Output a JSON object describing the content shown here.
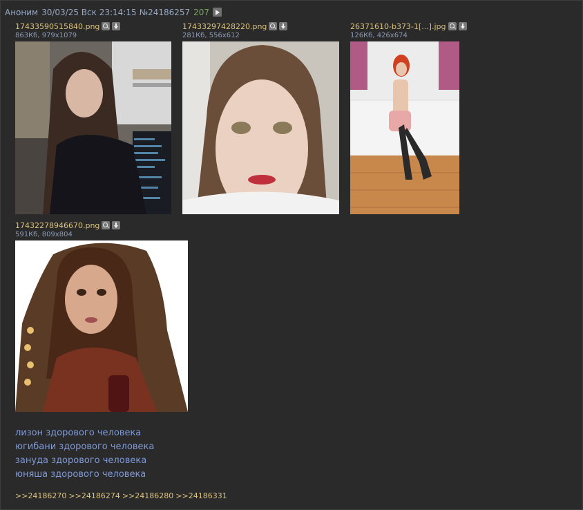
{
  "post": {
    "author": "Аноним",
    "datetime": "30/03/25 Вск 23:14:15",
    "number": "№24186257",
    "reply_count": "207"
  },
  "files": [
    {
      "name": "17433590515840.png",
      "meta": "863Кб, 979x1079"
    },
    {
      "name": "17433297428220.png",
      "meta": "281Кб, 556x612"
    },
    {
      "name": "26371610-b373-1[...].jpg",
      "meta": "126Кб, 426x674"
    },
    {
      "name": "17432278946670.png",
      "meta": "591Кб, 809x804"
    }
  ],
  "message": [
    "лизон здорового человека",
    "югибани здорового человека",
    "зануда здорового человека",
    "юняша здорового человека"
  ],
  "replies": [
    ">>24186270",
    ">>24186274",
    ">>24186280",
    ">>24186331"
  ],
  "icons": {
    "play": "play-icon",
    "search": "search-icon",
    "download": "download-icon"
  }
}
